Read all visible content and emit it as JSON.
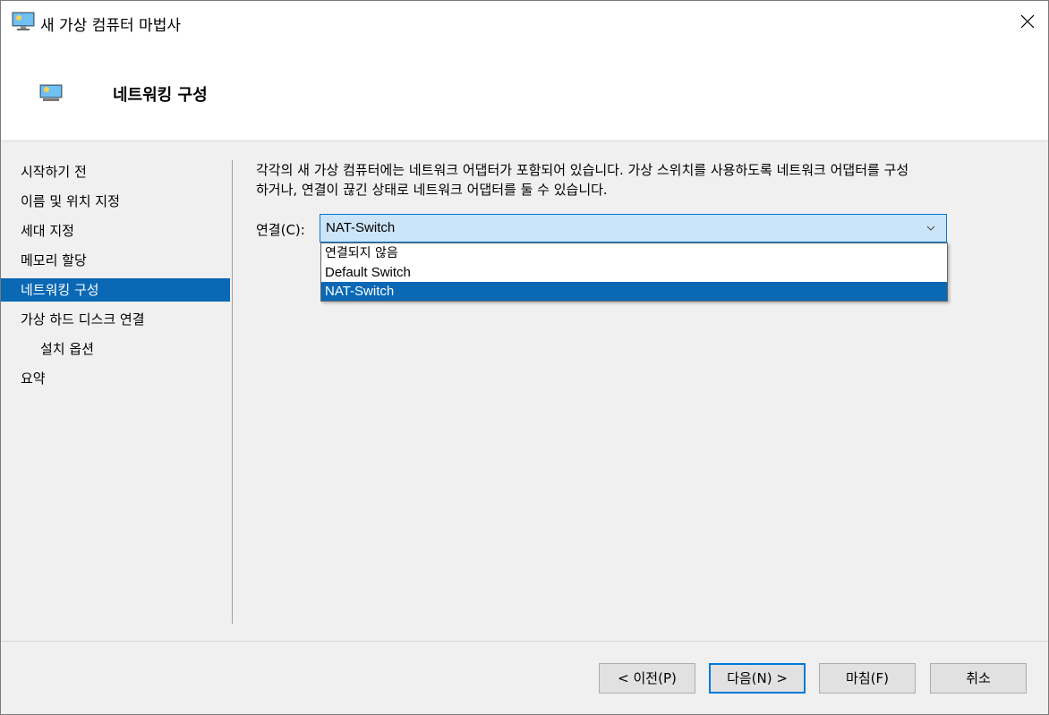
{
  "window": {
    "title": "새 가상 컴퓨터 마법사"
  },
  "header": {
    "title": "네트워킹 구성"
  },
  "sidebar": {
    "items": [
      {
        "label": "시작하기 전",
        "selected": false,
        "sub": false
      },
      {
        "label": "이름 및 위치 지정",
        "selected": false,
        "sub": false
      },
      {
        "label": "세대 지정",
        "selected": false,
        "sub": false
      },
      {
        "label": "메모리 할당",
        "selected": false,
        "sub": false
      },
      {
        "label": "네트워킹 구성",
        "selected": true,
        "sub": false
      },
      {
        "label": "가상 하드 디스크 연결",
        "selected": false,
        "sub": false
      },
      {
        "label": "설치 옵션",
        "selected": false,
        "sub": true
      },
      {
        "label": "요약",
        "selected": false,
        "sub": false
      }
    ]
  },
  "main": {
    "description_line1": "각각의 새 가상 컴퓨터에는 네트워크 어댑터가 포함되어 있습니다. 가상 스위치를 사용하도록 네트워크 어댑터를 구성",
    "description_line2": "하거나, 연결이 끊긴 상태로 네트워크 어댑터를 둘 수 있습니다.",
    "connection_label": "연결(C):",
    "connection_value": "NAT-Switch",
    "dropdown_options": [
      "연결되지 않음",
      "Default Switch",
      "NAT-Switch"
    ],
    "dropdown_selected_index": 2
  },
  "footer": {
    "prev_label": "< 이전(P)",
    "next_label": "다음(N) >",
    "finish_label": "마침(F)",
    "cancel_label": "취소"
  },
  "colors": {
    "selection": "#0a68b5",
    "combo_bg": "#cce4f7",
    "combo_border": "#0078d7"
  },
  "icons": {
    "window": "monitor-icon",
    "header": "monitor-icon",
    "close": "close-icon",
    "dropdown": "chevron-down-icon"
  }
}
